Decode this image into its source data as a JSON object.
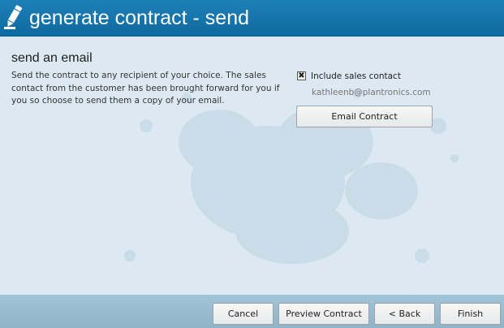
{
  "header": {
    "title": "generate contract - send",
    "icon": "pencil-icon",
    "background_color": "#1577ad"
  },
  "email_section": {
    "title": "send an email",
    "description": "Send the contract to any recipient of your choice. The sales contact from the customer has been brought forward for you if you so choose to send them a copy of your email.",
    "include_sales_contact": {
      "label": "Include sales contact",
      "checked": true,
      "check_mark": "✖"
    },
    "sales_contact_email": "kathleenb@plantronics.com",
    "email_button_label": "Email Contract"
  },
  "footer": {
    "buttons": [
      {
        "id": "cancel",
        "label": "Cancel"
      },
      {
        "id": "preview",
        "label": "Preview Contract"
      },
      {
        "id": "back",
        "label": "< Back"
      },
      {
        "id": "finish",
        "label": "Finish"
      }
    ]
  }
}
